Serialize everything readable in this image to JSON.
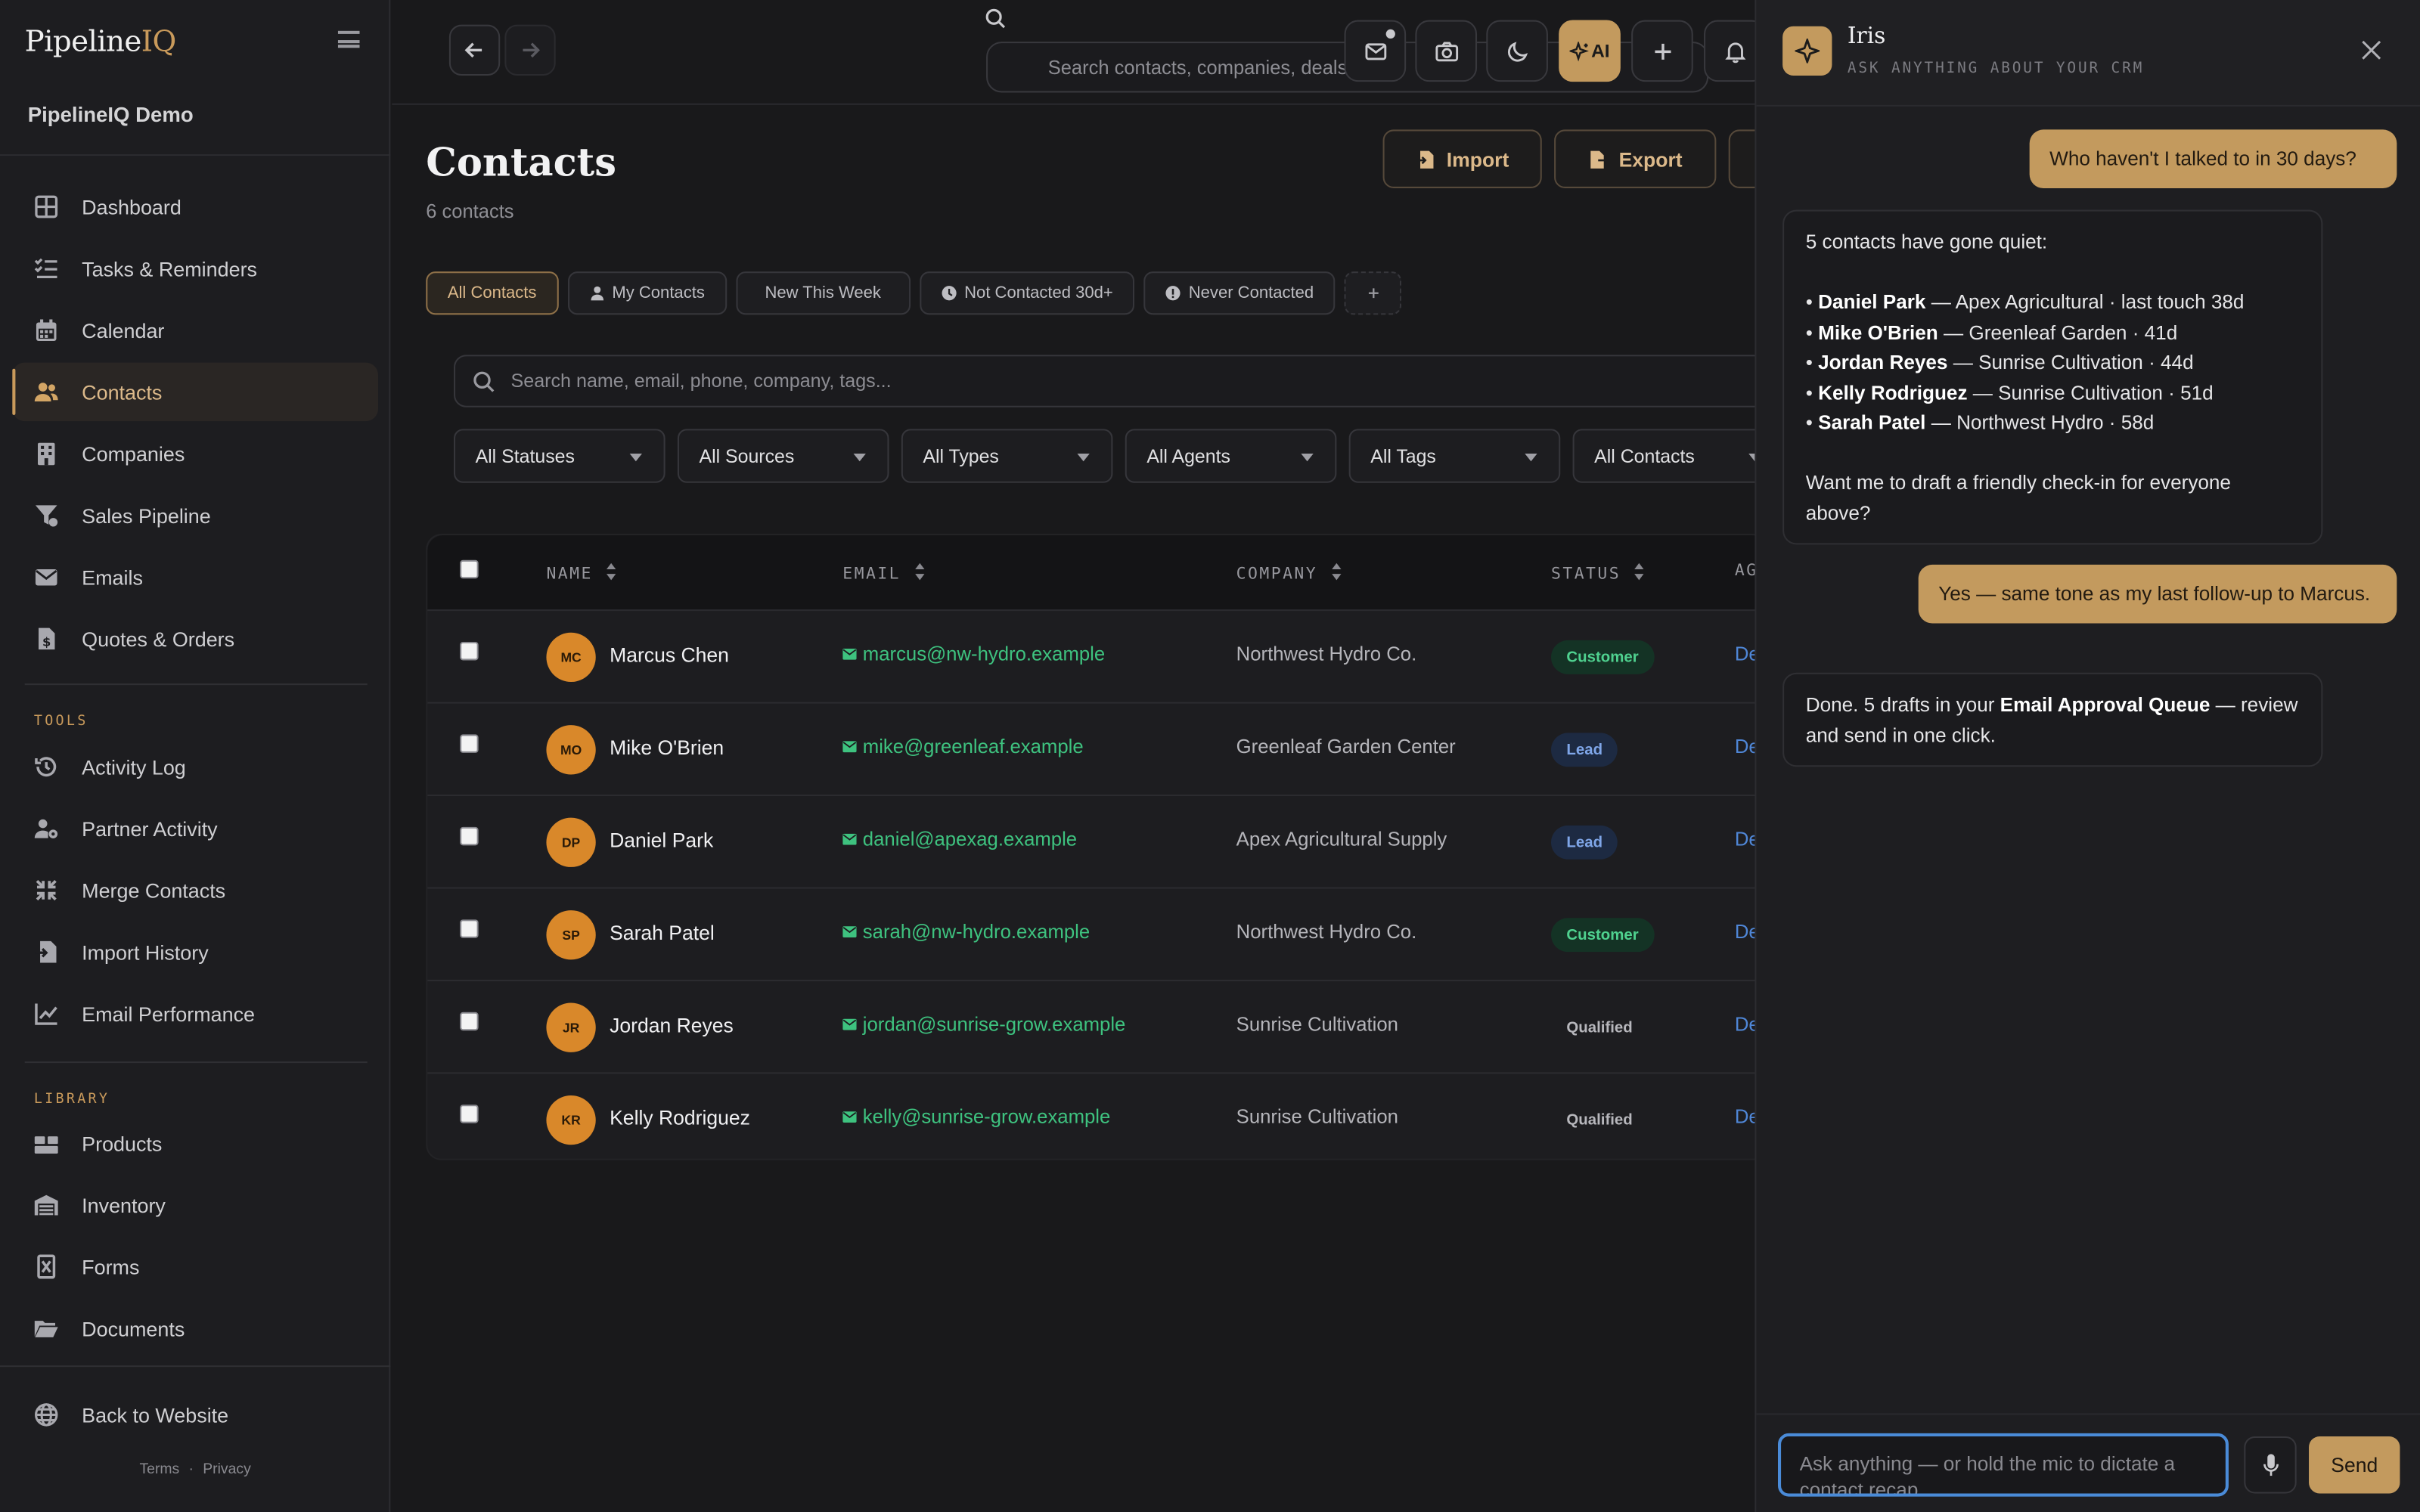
{
  "brand": {
    "name_a": "Pipeline",
    "name_b": "IQ"
  },
  "workspace": "PipelineIQ Demo",
  "nav_main": [
    {
      "label": "Dashboard",
      "icon": "dashboard-icon"
    },
    {
      "label": "Tasks & Reminders",
      "icon": "tasks-icon"
    },
    {
      "label": "Calendar",
      "icon": "calendar-icon"
    },
    {
      "label": "Contacts",
      "icon": "contacts-icon",
      "active": true
    },
    {
      "label": "Companies",
      "icon": "building-icon"
    },
    {
      "label": "Sales Pipeline",
      "icon": "funnel-icon"
    },
    {
      "label": "Emails",
      "icon": "mail-icon"
    },
    {
      "label": "Quotes & Orders",
      "icon": "document-dollar-icon"
    }
  ],
  "tools_label": "TOOLS",
  "nav_tools": [
    {
      "label": "Activity Log",
      "icon": "history-icon"
    },
    {
      "label": "Partner Activity",
      "icon": "user-gear-icon"
    },
    {
      "label": "Merge Contacts",
      "icon": "merge-icon"
    },
    {
      "label": "Import History",
      "icon": "file-import-icon"
    },
    {
      "label": "Email Performance",
      "icon": "chart-line-icon"
    }
  ],
  "library_label": "LIBRARY",
  "nav_library": [
    {
      "label": "Products",
      "icon": "boxes-icon"
    },
    {
      "label": "Inventory",
      "icon": "warehouse-icon"
    },
    {
      "label": "Forms",
      "icon": "form-icon"
    },
    {
      "label": "Documents",
      "icon": "folder-open-icon"
    }
  ],
  "back_to_website": "Back to Website",
  "footer": {
    "terms": "Terms",
    "dot": "·",
    "privacy": "Privacy"
  },
  "topbar": {
    "search_placeholder": "Search contacts, companies, deals...",
    "ai_label": "AI"
  },
  "page": {
    "title": "Contacts",
    "count_text": "6 contacts",
    "import_label": "Import",
    "export_label": "Export"
  },
  "chips": [
    "All Contacts",
    "My Contacts",
    "New This Week",
    "Not Contacted 30d+",
    "Never Contacted"
  ],
  "list_search_placeholder": "Search name, email, phone, company, tags...",
  "filters": [
    "All Statuses",
    "All Sources",
    "All Types",
    "All Agents",
    "All Tags",
    "All Contacts"
  ],
  "table": {
    "headers": {
      "name": "NAME",
      "email": "EMAIL",
      "company": "COMPANY",
      "status": "STATUS",
      "agent": "AG"
    },
    "rows": [
      {
        "initials": "MC",
        "name": "Marcus Chen",
        "email": "marcus@nw-hydro.example",
        "company": "Northwest Hydro Co.",
        "status": "Customer",
        "agent": "De"
      },
      {
        "initials": "MO",
        "name": "Mike O'Brien",
        "email": "mike@greenleaf.example",
        "company": "Greenleaf Garden Center",
        "status": "Lead",
        "agent": "De"
      },
      {
        "initials": "DP",
        "name": "Daniel Park",
        "email": "daniel@apexag.example",
        "company": "Apex Agricultural Supply",
        "status": "Lead",
        "agent": "De"
      },
      {
        "initials": "SP",
        "name": "Sarah Patel",
        "email": "sarah@nw-hydro.example",
        "company": "Northwest Hydro Co.",
        "status": "Customer",
        "agent": "De"
      },
      {
        "initials": "JR",
        "name": "Jordan Reyes",
        "email": "jordan@sunrise-grow.example",
        "company": "Sunrise Cultivation",
        "status": "Qualified",
        "agent": "De"
      },
      {
        "initials": "KR",
        "name": "Kelly Rodriguez",
        "email": "kelly@sunrise-grow.example",
        "company": "Sunrise Cultivation",
        "status": "Qualified",
        "agent": "De"
      }
    ]
  },
  "assistant": {
    "name": "Iris",
    "subtitle": "ASK ANYTHING ABOUT YOUR CRM",
    "msg1": "Who haven't I talked to in 30 days?",
    "reply1_intro": "5 contacts have gone quiet:",
    "reply1_items": [
      {
        "name": "Daniel Park",
        "detail": " — Apex Agricultural · last touch 38d"
      },
      {
        "name": "Mike O'Brien",
        "detail": " — Greenleaf Garden · 41d"
      },
      {
        "name": "Jordan Reyes",
        "detail": " — Sunrise Cultivation · 44d"
      },
      {
        "name": "Kelly Rodriguez",
        "detail": " — Sunrise Cultivation · 51d"
      },
      {
        "name": "Sarah Patel",
        "detail": " — Northwest Hydro · 58d"
      }
    ],
    "reply1_outro": "Want me to draft a friendly check-in for everyone above?",
    "msg2": "Yes — same tone as my last follow-up to Marcus.",
    "reply2_a": "Done. 5 drafts in your ",
    "reply2_b": "Email Approval Queue",
    "reply2_c": " — review and send in one click.",
    "input_placeholder": "Ask anything — or hold the mic to dictate a contact recap",
    "send_label": "Send"
  },
  "colors": {
    "accent": "#c39a5e",
    "email_link": "#3ec27f",
    "customer": "#4fd18f",
    "lead": "#7fa6e8"
  }
}
